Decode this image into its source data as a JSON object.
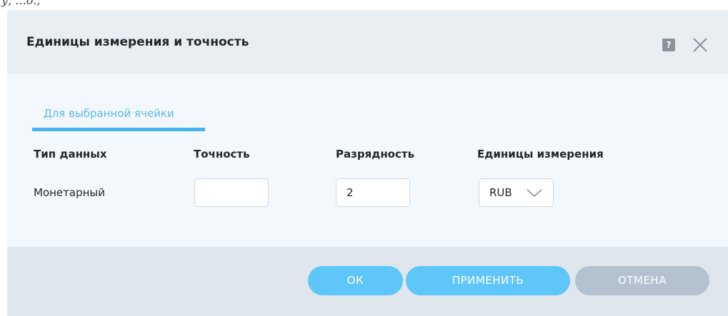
{
  "top_fragment": "у, ...о.,",
  "dialog": {
    "title": "Единицы измерения и точность",
    "help_label": "?",
    "tabs": [
      {
        "label": "Для выбранной ячейки"
      }
    ],
    "columns": {
      "data_type": "Тип данных",
      "precision": "Точность",
      "digits": "Разрядность",
      "units": "Единицы измерения"
    },
    "row": {
      "data_type": "Монетарный",
      "precision": "",
      "digits": "2",
      "units": "RUB"
    },
    "buttons": {
      "ok": "ОК",
      "apply": "ПРИМЕНИТЬ",
      "cancel": "ОТМЕНА"
    }
  },
  "colors": {
    "accent": "#45b4ef",
    "primary_button": "#5ec6f8",
    "secondary_button": "#b4c2cf",
    "header_bg": "#e9eef3",
    "content_bg": "#f3f8fc",
    "footer_bg": "#dfe6ec"
  },
  "icons": {
    "help": "help-icon",
    "close": "close-icon",
    "dropdown": "chevron-down-icon"
  }
}
